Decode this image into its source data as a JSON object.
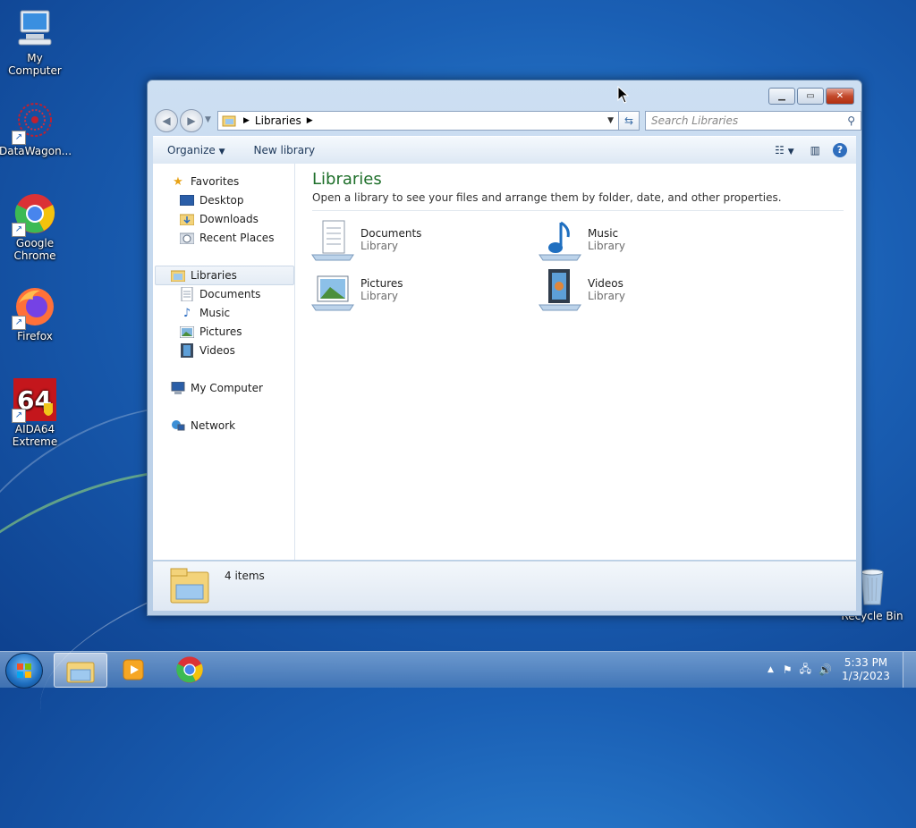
{
  "desktop": {
    "icons": [
      {
        "label": "My Computer",
        "icon": "computer-icon"
      },
      {
        "label": "DataWagon...",
        "icon": "datawagon-icon"
      },
      {
        "label": "Google Chrome",
        "icon": "chrome-icon"
      },
      {
        "label": "Firefox",
        "icon": "firefox-icon"
      },
      {
        "label": "AIDA64 Extreme",
        "icon": "aida64-icon"
      },
      {
        "label": "Recycle Bin",
        "icon": "recycle-bin-icon"
      }
    ]
  },
  "window": {
    "address": {
      "crumb": "Libraries"
    },
    "search": {
      "placeholder": "Search Libraries"
    },
    "toolbar": {
      "organize": "Organize",
      "new_library": "New library"
    },
    "nav": {
      "favorites": "Favorites",
      "favorites_items": [
        "Desktop",
        "Downloads",
        "Recent Places"
      ],
      "libraries": "Libraries",
      "libraries_items": [
        "Documents",
        "Music",
        "Pictures",
        "Videos"
      ],
      "computer": "My Computer",
      "network": "Network"
    },
    "main": {
      "title": "Libraries",
      "subtitle": "Open a library to see your files and arrange them by folder, date, and other properties.",
      "libraries": [
        {
          "name": "Documents",
          "type": "Library",
          "icon": "documents-library-icon"
        },
        {
          "name": "Music",
          "type": "Library",
          "icon": "music-library-icon"
        },
        {
          "name": "Pictures",
          "type": "Library",
          "icon": "pictures-library-icon"
        },
        {
          "name": "Videos",
          "type": "Library",
          "icon": "videos-library-icon"
        }
      ]
    },
    "details": {
      "count": "4 items"
    }
  },
  "taskbar": {
    "time": "5:33 PM",
    "date": "1/3/2023",
    "accent": "#1f6fc0"
  }
}
